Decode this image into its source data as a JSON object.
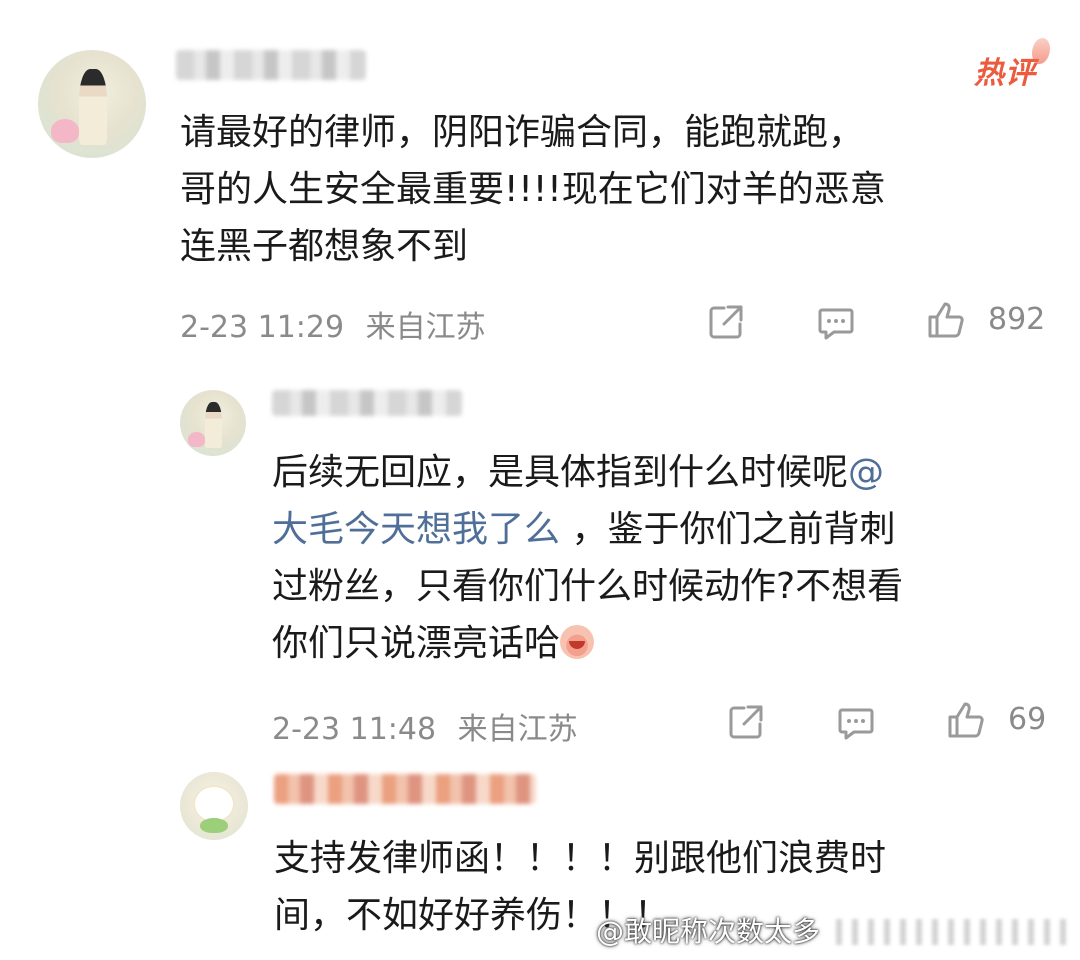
{
  "comments": [
    {
      "hot_label": "热评",
      "text": "请最好的律师，阴阳诈骗合同，能跑就跑，\n哥的人生安全最重要!!!!现在它们对羊的恶意\n连黑子都想象不到",
      "time": "2-23 11:29",
      "location": "来自江苏",
      "like_count": "892"
    },
    {
      "text_before_mention": "后续无回应，是具体指到什么时候呢",
      "mention": "@\n大毛今天想我了么",
      "text_after_mention": " ，鉴于你们之前背刺\n过粉丝，只看你们什么时候动作?不想看\n你们只说漂亮话哈",
      "emoji": "laughing-emoji",
      "time": "2-23 11:48",
      "location": "来自江苏",
      "like_count": "69"
    },
    {
      "text": "支持发律师函！！！！别跟他们浪费时\n间，不如好好养伤！！！"
    }
  ],
  "watermark": {
    "text": "@敢昵称次数太多"
  },
  "icons": {
    "share": "share-icon",
    "comment": "comment-icon",
    "like": "thumbs-up-icon"
  },
  "colors": {
    "hot": "#ec5b3f",
    "mention": "#4f6f98",
    "meta": "#8a8a8a"
  }
}
